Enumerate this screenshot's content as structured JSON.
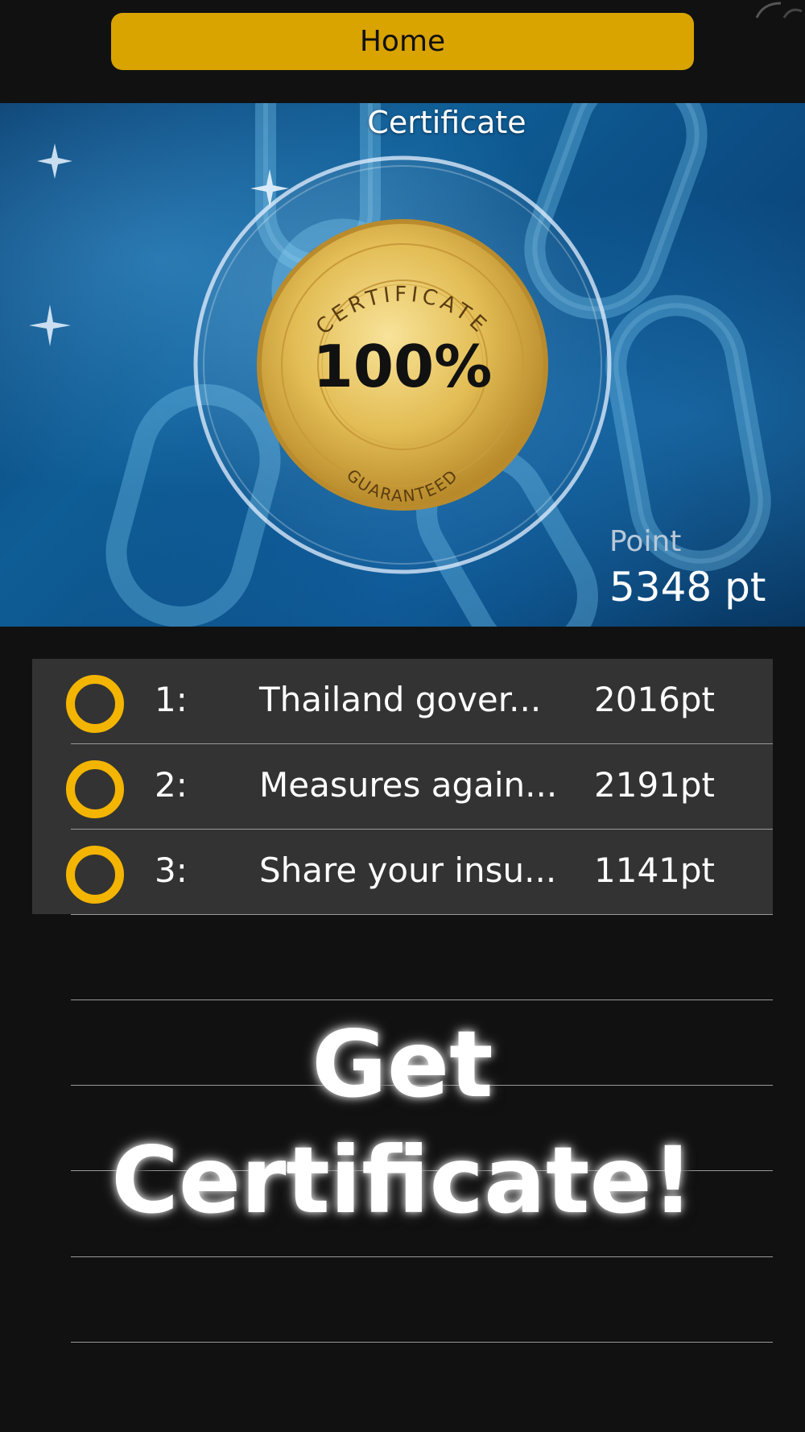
{
  "header": {
    "home_label": "Home"
  },
  "hero": {
    "title": "Certificate",
    "badge_top_text": "CERTIFICATE",
    "badge_center_text": "100%",
    "badge_bottom_text": "GUARANTEED",
    "point_label": "Point",
    "point_value": "5348 pt"
  },
  "certificates": [
    {
      "num": "1:",
      "title": "Thailand gover...",
      "points": "2016pt"
    },
    {
      "num": "2:",
      "title": "Measures again...",
      "points": "2191pt"
    },
    {
      "num": "3:",
      "title": "Share your insu...",
      "points": "1141pt"
    }
  ],
  "cta": {
    "line1": "Get",
    "line2": "Certificate!"
  },
  "colors": {
    "accent": "#d9a300",
    "ring": "#f4b500",
    "list_bg": "#333333",
    "page_bg": "#111111"
  }
}
